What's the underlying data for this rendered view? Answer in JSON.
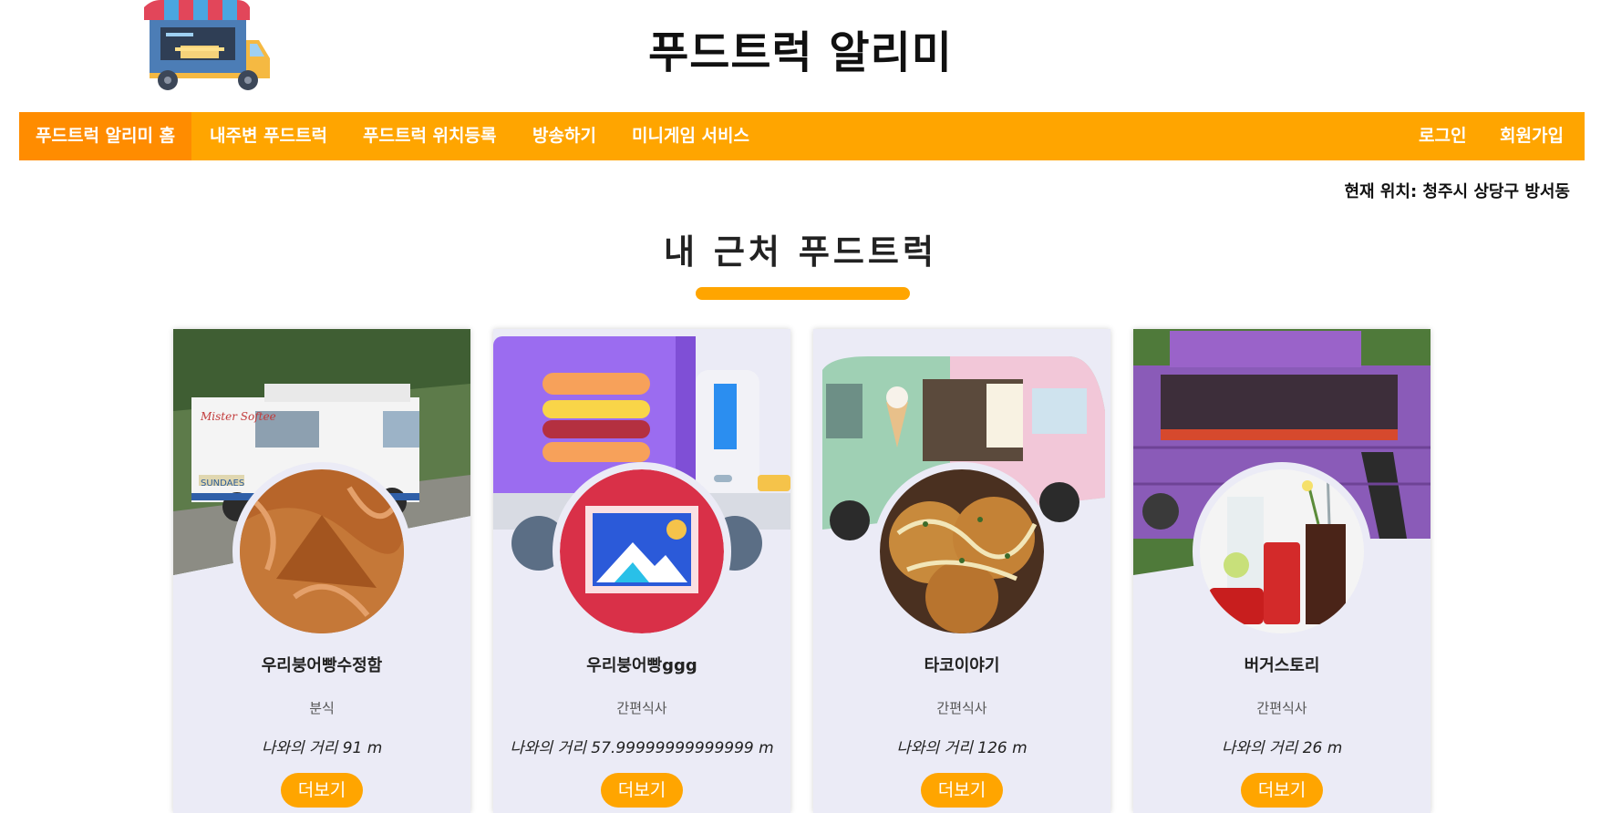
{
  "header": {
    "title": "푸드트럭 알리미",
    "logo_icon": "food-truck-icon"
  },
  "nav": {
    "items": [
      {
        "label": "푸드트럭 알리미 홈",
        "active": true
      },
      {
        "label": "내주변 푸드트럭"
      },
      {
        "label": "푸드트럭 위치등록"
      },
      {
        "label": "방송하기"
      },
      {
        "label": "미니게임 서비스"
      }
    ],
    "login": "로그인",
    "signup": "회원가입"
  },
  "location": {
    "text": "현재 위치: 청주시 상당구 방서동"
  },
  "section": {
    "title": "내 근처 푸드트럭"
  },
  "cards": [
    {
      "name": "우리붕어빵수정함",
      "category": "분식",
      "distance": "나와의 거리 91 m",
      "more": "더보기"
    },
    {
      "name": "우리붕어빵ggg",
      "category": "간편식사",
      "distance": "나와의 거리 57.99999999999999 m",
      "more": "더보기"
    },
    {
      "name": "타코이야기",
      "category": "간편식사",
      "distance": "나와의 거리 126 m",
      "more": "더보기"
    },
    {
      "name": "버거스토리",
      "category": "간편식사",
      "distance": "나와의 거리 26 m",
      "more": "더보기"
    }
  ],
  "colors": {
    "accent": "#ffa500",
    "active_nav": "#ff8c00",
    "card_bg": "#ebebf6"
  }
}
